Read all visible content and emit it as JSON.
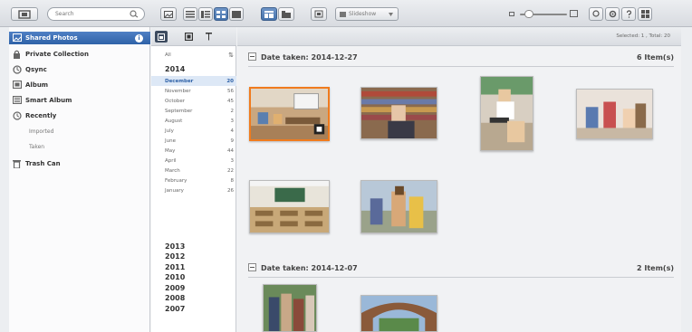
{
  "toolbar": {
    "search_placeholder": "Search",
    "dropdown_label": "Slideshow"
  },
  "sidebar": {
    "items": [
      {
        "label": "Shared Photos",
        "icon": "shared-photos-icon"
      },
      {
        "label": "Private Collection",
        "icon": "lock-icon"
      },
      {
        "label": "Qsync",
        "icon": "sync-icon"
      },
      {
        "label": "Album",
        "icon": "album-icon"
      },
      {
        "label": "Smart Album",
        "icon": "smart-album-icon"
      },
      {
        "label": "Recently",
        "icon": "clock-icon"
      },
      {
        "label": "Trash Can",
        "icon": "trash-icon"
      }
    ],
    "recently_sub": [
      "Imported",
      "Taken"
    ]
  },
  "datecol": {
    "all_label": "All",
    "sort_label": "⇅",
    "years_top": [
      "2014"
    ],
    "months": [
      {
        "name": "December",
        "count": "20"
      },
      {
        "name": "November",
        "count": "56"
      },
      {
        "name": "October",
        "count": "45"
      },
      {
        "name": "September",
        "count": "2"
      },
      {
        "name": "August",
        "count": "3"
      },
      {
        "name": "July",
        "count": "4"
      },
      {
        "name": "June",
        "count": "9"
      },
      {
        "name": "May",
        "count": "44"
      },
      {
        "name": "April",
        "count": "3"
      },
      {
        "name": "March",
        "count": "22"
      },
      {
        "name": "February",
        "count": "8"
      },
      {
        "name": "January",
        "count": "26"
      }
    ],
    "years_bottom": [
      "2013",
      "2012",
      "2011",
      "2010",
      "2009",
      "2008",
      "2007"
    ]
  },
  "main": {
    "selected_info": "Selected: 1 , Total: 20",
    "groups": [
      {
        "title": "Date taken: 2014-12-27",
        "items": "6 Item(s)"
      },
      {
        "title": "Date taken: 2014-12-07",
        "items": "2 Item(s)"
      }
    ]
  },
  "colors": {
    "accent": "#2f62a8",
    "selection_border": "#f07b1d"
  }
}
